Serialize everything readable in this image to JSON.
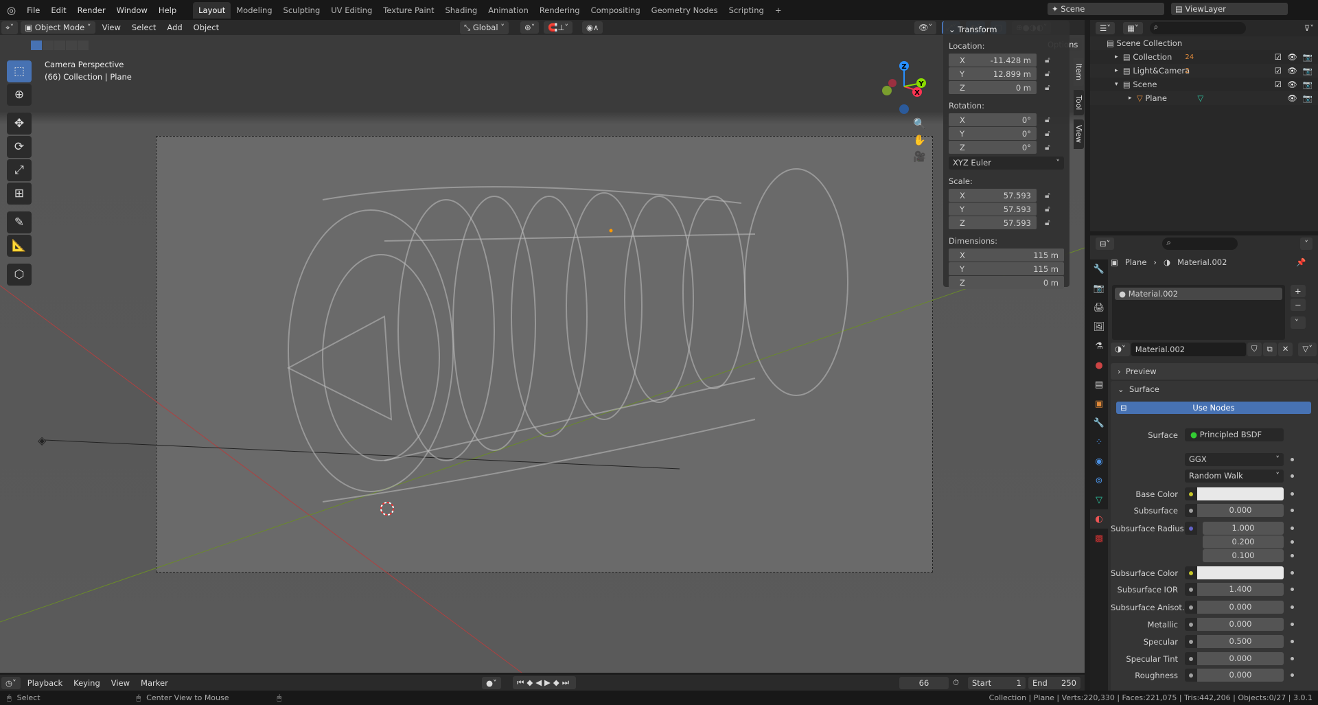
{
  "topbar": {
    "menus": [
      "File",
      "Edit",
      "Render",
      "Window",
      "Help"
    ],
    "workspaces": [
      "Layout",
      "Modeling",
      "Sculpting",
      "UV Editing",
      "Texture Paint",
      "Shading",
      "Animation",
      "Rendering",
      "Compositing",
      "Geometry Nodes",
      "Scripting"
    ],
    "active_workspace": "Layout",
    "add": "+",
    "scene": "Scene",
    "view_layer": "ViewLayer"
  },
  "header": {
    "mode": "Object Mode",
    "menus": [
      "View",
      "Select",
      "Add",
      "Object"
    ],
    "orientation": "Global",
    "options": "Options"
  },
  "viewport": {
    "view_name": "Camera Perspective",
    "context": "(66) Collection | Plane"
  },
  "npanel": {
    "title": "Transform",
    "location_label": "Location:",
    "location": [
      {
        "axis": "X",
        "value": "-11.428 m"
      },
      {
        "axis": "Y",
        "value": "12.899 m"
      },
      {
        "axis": "Z",
        "value": "0 m"
      }
    ],
    "rotation_label": "Rotation:",
    "rotation": [
      {
        "axis": "X",
        "value": "0°"
      },
      {
        "axis": "Y",
        "value": "0°"
      },
      {
        "axis": "Z",
        "value": "0°"
      }
    ],
    "rotation_mode": "XYZ Euler",
    "scale_label": "Scale:",
    "scale": [
      {
        "axis": "X",
        "value": "57.593"
      },
      {
        "axis": "Y",
        "value": "57.593"
      },
      {
        "axis": "Z",
        "value": "57.593"
      }
    ],
    "dimensions_label": "Dimensions:",
    "dimensions": [
      {
        "axis": "X",
        "value": "115 m"
      },
      {
        "axis": "Y",
        "value": "115 m"
      },
      {
        "axis": "Z",
        "value": "0 m"
      }
    ],
    "tabs": [
      "Item",
      "Tool",
      "View"
    ]
  },
  "outliner": {
    "root": "Scene Collection",
    "items": [
      {
        "name": "Collection",
        "badge": "24"
      },
      {
        "name": "Light&Camera",
        "badge": "2"
      },
      {
        "name": "Scene",
        "badge": ""
      },
      {
        "name": "Plane",
        "badge": ""
      }
    ]
  },
  "properties": {
    "breadcrumb_object": "Plane",
    "breadcrumb_material": "Material.002",
    "slot": "Material.002",
    "material_name": "Material.002",
    "preview": "Preview",
    "surface_panel": "Surface",
    "use_nodes": "Use Nodes",
    "surface_label": "Surface",
    "surface_shader": "Principled BSDF",
    "distribution": "GGX",
    "subsurface_method": "Random Walk",
    "fields": [
      {
        "label": "Base Color",
        "type": "color",
        "value": "",
        "socket": "#c7c729"
      },
      {
        "label": "Subsurface",
        "value": "0.000",
        "fill": 0
      },
      {
        "label": "Subsurface Radius",
        "value": "1.000",
        "socket": "#6363c7",
        "vector": [
          "1.000",
          "0.200",
          "0.100"
        ]
      },
      {
        "label": "Subsurface Color",
        "type": "color",
        "value": "",
        "socket": "#c7c729"
      },
      {
        "label": "Subsurface IOR",
        "value": "1.400",
        "fill": 0.08
      },
      {
        "label": "Subsurface Anisot...",
        "value": "0.000",
        "fill": 0
      },
      {
        "label": "Metallic",
        "value": "0.000",
        "fill": 0
      },
      {
        "label": "Specular",
        "value": "0.500",
        "fill": 0.5
      },
      {
        "label": "Specular Tint",
        "value": "0.000",
        "fill": 0
      },
      {
        "label": "Roughness",
        "value": "0.000",
        "fill": 0
      }
    ]
  },
  "timeline": {
    "menus": [
      "Playback",
      "Keying",
      "View",
      "Marker"
    ],
    "current_frame": "66",
    "start_label": "Start",
    "start": "1",
    "end_label": "End",
    "end": "250"
  },
  "status": {
    "select": "Select",
    "center": "Center View to Mouse",
    "stats": "Collection | Plane | Verts:220,330 | Faces:221,075 | Tris:442,206 | Objects:0/27 | 3.0.1"
  },
  "colors": {
    "accent": "#4772b3",
    "x_axis": "#ff3352",
    "y_axis": "#8bdc00",
    "z_axis": "#2890ff"
  }
}
